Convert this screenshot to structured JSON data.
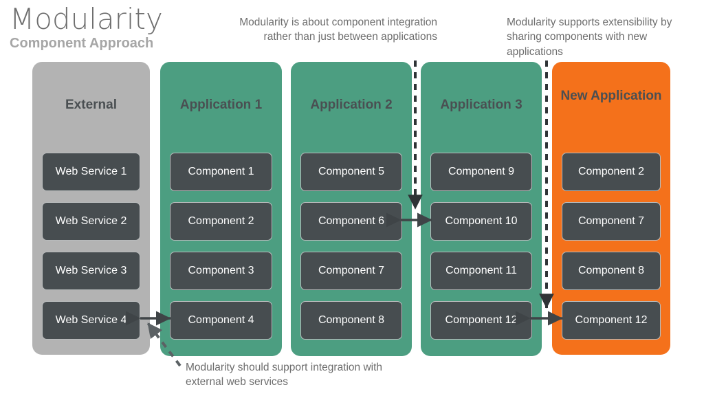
{
  "header": {
    "title": "Modularity",
    "subtitle": "Component Approach"
  },
  "annotations": {
    "integration": "Modularity is about component integration rather than just between applications",
    "extensibility": "Modularity supports extensibility by sharing components with new applications",
    "external": "Modularity should support integration with external web services"
  },
  "colors": {
    "external_column": "#b3b3b3",
    "application_column": "#4c9e81",
    "new_application_column": "#f4711b",
    "node_box": "#474d50",
    "node_border": "#b9bcbd",
    "title_text": "#6e6e6e",
    "subtitle_text": "#a6a6a6",
    "column_title_text": "#4a4f52",
    "annotation_text": "#6d6d6d",
    "arrow": "#3f4447"
  },
  "columns": [
    {
      "id": "external",
      "title": "External",
      "items": [
        "Web Service 1",
        "Web Service 2",
        "Web Service 3",
        "Web Service 4"
      ]
    },
    {
      "id": "app1",
      "title": "Application 1",
      "items": [
        "Component 1",
        "Component 2",
        "Component 3",
        "Component 4"
      ]
    },
    {
      "id": "app2",
      "title": "Application 2",
      "items": [
        "Component 5",
        "Component 6",
        "Component 7",
        "Component 8"
      ]
    },
    {
      "id": "app3",
      "title": "Application 3",
      "items": [
        "Component 9",
        "Component 10",
        "Component 11",
        "Component 12"
      ]
    },
    {
      "id": "newapp",
      "title": "New Application",
      "items": [
        "Component 2",
        "Component 7",
        "Component 8",
        "Component 12"
      ]
    }
  ],
  "connectors": [
    {
      "name": "web-service-4-to-component-4",
      "type": "double-arrow-horizontal"
    },
    {
      "name": "component-6-to-component-10",
      "type": "double-arrow-horizontal"
    },
    {
      "name": "component-12-to-component-12",
      "type": "double-arrow-horizontal"
    },
    {
      "name": "integration-callout-line",
      "type": "dashed-arrow-vertical"
    },
    {
      "name": "extensibility-callout-line",
      "type": "dashed-arrow-vertical"
    },
    {
      "name": "external-callout-line",
      "type": "dashed-arrow-diagonal"
    }
  ]
}
